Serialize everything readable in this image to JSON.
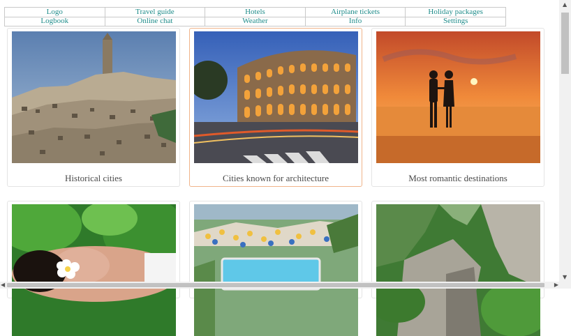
{
  "nav": {
    "row1": [
      "Logo",
      "Travel guide",
      "Hotels",
      "Airplane tickets",
      "Holiday packages"
    ],
    "row2": [
      "Logbook",
      "Online chat",
      "Weather",
      "Info",
      "Settings"
    ]
  },
  "cards": [
    {
      "caption": "Historical cities",
      "photo": "hilltop-stone-town-photo"
    },
    {
      "caption": "Cities known for architecture",
      "photo": "colosseum-at-dusk-photo"
    },
    {
      "caption": "Most romantic destinations",
      "photo": "couple-at-sunset-beach-photo"
    },
    {
      "caption": "",
      "photo": "spa-woman-with-flower-photo"
    },
    {
      "caption": "",
      "photo": "water-park-pool-photo"
    },
    {
      "caption": "",
      "photo": "mountain-gorge-photo"
    }
  ],
  "colors": {
    "nav_text": "#1e8c8a",
    "active_border": "#f0b48a"
  },
  "scrollbar_icons": [
    "up-arrow-icon",
    "down-arrow-icon",
    "left-arrow-icon",
    "right-arrow-icon"
  ]
}
